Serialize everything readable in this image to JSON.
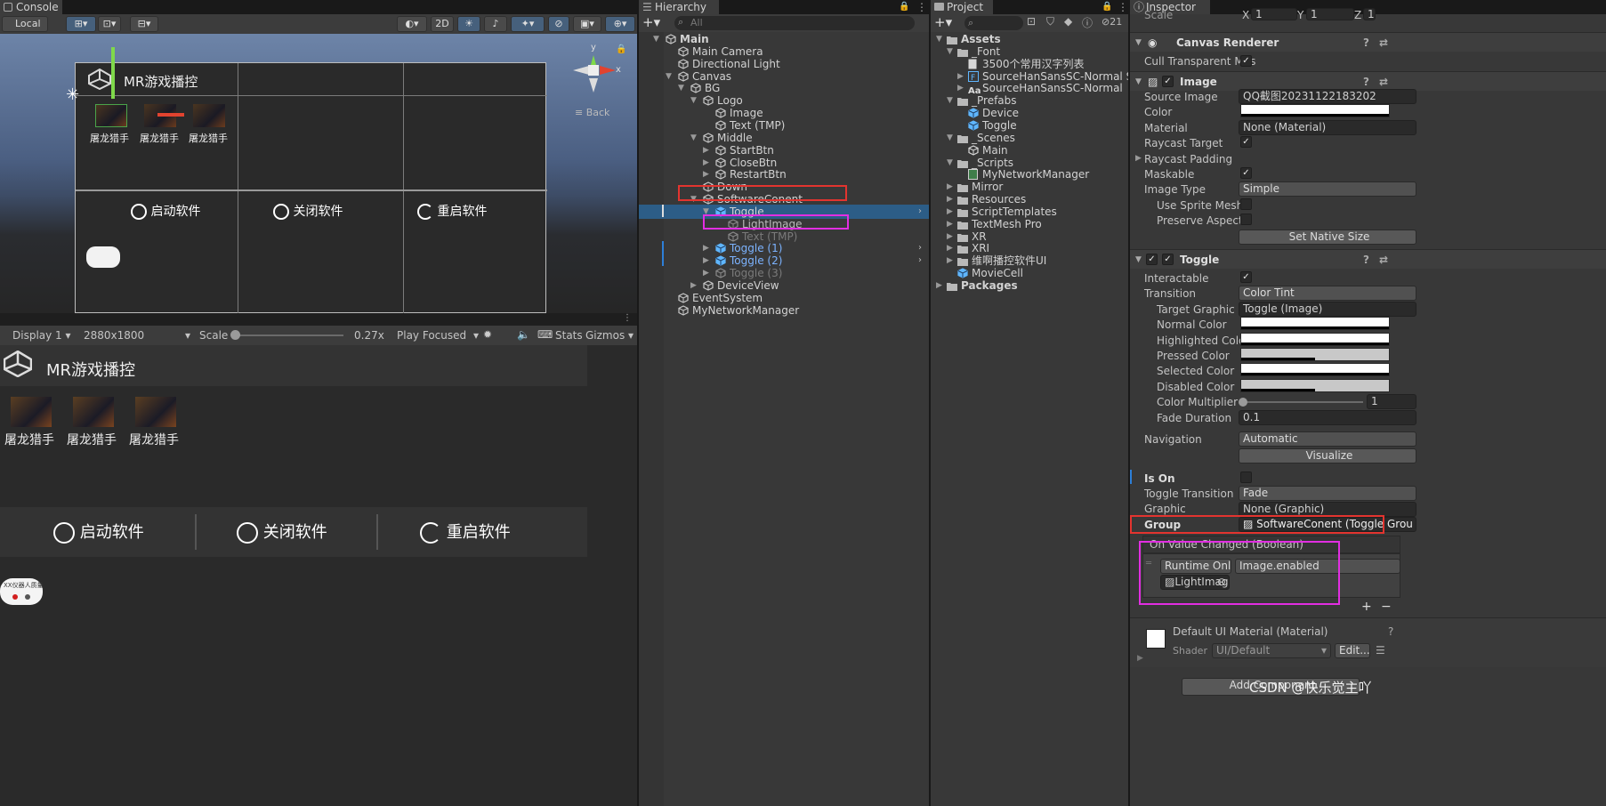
{
  "scene": {
    "tab_label": "Console",
    "local_label": "Local",
    "mode_2d": "2D",
    "back_label": "Back",
    "gizmo_y": "y",
    "gizmo_x": "x",
    "title": "MR游戏播控",
    "item_labels": [
      "屠龙猎手",
      "屠龙猎手",
      "屠龙猎手"
    ],
    "buttons": [
      "启动软件",
      "关闭软件",
      "重启软件"
    ]
  },
  "game": {
    "display": "Display 1",
    "resolution": "2880x1800",
    "scale_label": "Scale",
    "scale_value": "0.27x",
    "scale_fraction": 0.02,
    "play_mode": "Play Focused",
    "stats": "Stats",
    "gizmos": "Gizmos",
    "title": "MR游戏播控",
    "item_labels": [
      "屠龙猎手",
      "屠龙猎手",
      "屠龙猎手"
    ],
    "buttons": [
      "启动软件",
      "关闭软件",
      "重启软件"
    ],
    "device_text": "XX仪器人质量"
  },
  "hierarchy": {
    "tab_label": "Hierarchy",
    "search_placeholder": "All",
    "rows": [
      {
        "label": "Main",
        "arrow": "▼",
        "indent": 0,
        "style": "scene"
      },
      {
        "label": "Main Camera",
        "arrow": "",
        "indent": 1,
        "style": ""
      },
      {
        "label": "Directional Light",
        "arrow": "",
        "indent": 1,
        "style": ""
      },
      {
        "label": "Canvas",
        "arrow": "▼",
        "indent": 1,
        "style": ""
      },
      {
        "label": "BG",
        "arrow": "▼",
        "indent": 2,
        "style": ""
      },
      {
        "label": "Logo",
        "arrow": "▼",
        "indent": 3,
        "style": ""
      },
      {
        "label": "Image",
        "arrow": "",
        "indent": 4,
        "style": ""
      },
      {
        "label": "Text (TMP)",
        "arrow": "",
        "indent": 4,
        "style": ""
      },
      {
        "label": "Middle",
        "arrow": "▼",
        "indent": 3,
        "style": ""
      },
      {
        "label": "StartBtn",
        "arrow": "▶",
        "indent": 4,
        "style": ""
      },
      {
        "label": "CloseBtn",
        "arrow": "▶",
        "indent": 4,
        "style": ""
      },
      {
        "label": "RestartBtn",
        "arrow": "▶",
        "indent": 4,
        "style": ""
      },
      {
        "label": "Down",
        "arrow": "",
        "indent": 3,
        "style": ""
      },
      {
        "label": "SoftwareConent",
        "arrow": "▼",
        "indent": 3,
        "style": ""
      },
      {
        "label": "Toggle",
        "arrow": "▼",
        "indent": 4,
        "style": "selected"
      },
      {
        "label": "LightImage",
        "arrow": "",
        "indent": 5,
        "style": "gray"
      },
      {
        "label": "Text (TMP)",
        "arrow": "",
        "indent": 5,
        "style": "gray"
      },
      {
        "label": "Toggle (1)",
        "arrow": "▶",
        "indent": 4,
        "style": "blue"
      },
      {
        "label": "Toggle (2)",
        "arrow": "▶",
        "indent": 4,
        "style": "blue"
      },
      {
        "label": "Toggle (3)",
        "arrow": "▶",
        "indent": 4,
        "style": "gray"
      },
      {
        "label": "DeviceView",
        "arrow": "▶",
        "indent": 3,
        "style": ""
      },
      {
        "label": "EventSystem",
        "arrow": "",
        "indent": 1,
        "style": ""
      },
      {
        "label": "MyNetworkManager",
        "arrow": "",
        "indent": 1,
        "style": ""
      }
    ]
  },
  "project": {
    "tab_label": "Project",
    "count": "21",
    "rows": [
      {
        "label": "Assets",
        "arrow": "▼",
        "indent": 0,
        "icon": "folder",
        "bold": true
      },
      {
        "label": "_Font",
        "arrow": "▼",
        "indent": 1,
        "icon": "folder"
      },
      {
        "label": "3500个常用汉字列表",
        "arrow": "",
        "indent": 2,
        "icon": "file"
      },
      {
        "label": "SourceHanSansSC-Normal SDF",
        "arrow": "▶",
        "indent": 2,
        "icon": "font"
      },
      {
        "label": "SourceHanSansSC-Normal",
        "arrow": "▶",
        "indent": 2,
        "icon": "aa"
      },
      {
        "label": "_Prefabs",
        "arrow": "▼",
        "indent": 1,
        "icon": "folder"
      },
      {
        "label": "Device",
        "arrow": "",
        "indent": 2,
        "icon": "prefab"
      },
      {
        "label": "Toggle",
        "arrow": "",
        "indent": 2,
        "icon": "prefab"
      },
      {
        "label": "_Scenes",
        "arrow": "▼",
        "indent": 1,
        "icon": "folder"
      },
      {
        "label": "Main",
        "arrow": "",
        "indent": 2,
        "icon": "scene"
      },
      {
        "label": "_Scripts",
        "arrow": "▼",
        "indent": 1,
        "icon": "folder"
      },
      {
        "label": "MyNetworkManager",
        "arrow": "",
        "indent": 2,
        "icon": "script"
      },
      {
        "label": "Mirror",
        "arrow": "▶",
        "indent": 1,
        "icon": "folder"
      },
      {
        "label": "Resources",
        "arrow": "▶",
        "indent": 1,
        "icon": "folder"
      },
      {
        "label": "ScriptTemplates",
        "arrow": "▶",
        "indent": 1,
        "icon": "folder"
      },
      {
        "label": "TextMesh Pro",
        "arrow": "▶",
        "indent": 1,
        "icon": "folder"
      },
      {
        "label": "XR",
        "arrow": "▶",
        "indent": 1,
        "icon": "folder"
      },
      {
        "label": "XRI",
        "arrow": "▶",
        "indent": 1,
        "icon": "folder"
      },
      {
        "label": "维啊播控软件UI",
        "arrow": "▶",
        "indent": 1,
        "icon": "folder"
      },
      {
        "label": "MovieCell",
        "arrow": "",
        "indent": 1,
        "icon": "prefab"
      },
      {
        "label": "Packages",
        "arrow": "▶",
        "indent": 0,
        "icon": "folder",
        "bold": true
      }
    ]
  },
  "inspector": {
    "tab_label": "Inspector",
    "scale_label": "Scale",
    "scale_x": "X",
    "scale_x_val": "1",
    "scale_y": "Y",
    "scale_y_val": "1",
    "scale_z": "Z",
    "scale_z_val": "1",
    "canvas_renderer": "Canvas Renderer",
    "cull_transparent": "Cull Transparent Mes",
    "image_title": "Image",
    "image_props": [
      {
        "label": "Source Image",
        "value": "QQ截图20231122183202",
        "kind": "field"
      },
      {
        "label": "Color",
        "value": "",
        "kind": "color"
      },
      {
        "label": "Material",
        "value": "None (Material)",
        "kind": "field"
      },
      {
        "label": "Raycast Target",
        "value": "✓",
        "kind": "check"
      },
      {
        "label": "Raycast Padding",
        "value": "",
        "kind": "fold"
      },
      {
        "label": "Maskable",
        "value": "✓",
        "kind": "check"
      },
      {
        "label": "Image Type",
        "value": "Simple",
        "kind": "drop"
      },
      {
        "label": "Use Sprite Mesh",
        "value": "",
        "kind": "check",
        "sub": true
      },
      {
        "label": "Preserve Aspect",
        "value": "",
        "kind": "check",
        "sub": true
      }
    ],
    "set_native_size": "Set Native Size",
    "toggle_title": "Toggle",
    "toggle_props": [
      {
        "label": "Interactable",
        "value": "✓",
        "kind": "check"
      },
      {
        "label": "Transition",
        "value": "Color Tint",
        "kind": "drop"
      },
      {
        "label": "Target Graphic",
        "value": "Toggle (Image)",
        "kind": "field",
        "sub": true
      },
      {
        "label": "Normal Color",
        "value": "",
        "kind": "color",
        "sub": true
      },
      {
        "label": "Highlighted Color",
        "value": "",
        "kind": "color",
        "sub": true
      },
      {
        "label": "Pressed Color",
        "value": "",
        "kind": "color",
        "sub": true,
        "tint": "#c8c8c8"
      },
      {
        "label": "Selected Color",
        "value": "",
        "kind": "color",
        "sub": true
      },
      {
        "label": "Disabled Color",
        "value": "",
        "kind": "color",
        "sub": true,
        "tint": "#c8c8c8"
      },
      {
        "label": "Color Multiplier",
        "value": "1",
        "kind": "slider",
        "sub": true
      },
      {
        "label": "Fade Duration",
        "value": "0.1",
        "kind": "field",
        "sub": true
      }
    ],
    "navigation_label": "Navigation",
    "navigation_value": "Automatic",
    "visualize": "Visualize",
    "is_on": "Is On",
    "toggle_transition_label": "Toggle Transition",
    "toggle_transition_value": "Fade",
    "graphic_label": "Graphic",
    "graphic_value": "None (Graphic)",
    "group_label": "Group",
    "group_value": "SoftwareConent (Toggle Grou",
    "on_value_changed": "On Value Changed (Boolean)",
    "runtime_only": "Runtime Only",
    "function_value": "Image.enabled",
    "object_value": "LightImage",
    "plus": "+",
    "minus": "−",
    "material_title": "Default UI Material (Material)",
    "shader_label": "Shader",
    "shader_value": "UI/Default",
    "edit_label": "Edit...",
    "add_component": "Add Component",
    "watermark": "CSDN @快乐觉主吖"
  },
  "colors": {
    "accent": "#2c5d87",
    "red": "#e3342f",
    "magenta": "#e22ee2",
    "prefab": "#5fb6ff"
  }
}
